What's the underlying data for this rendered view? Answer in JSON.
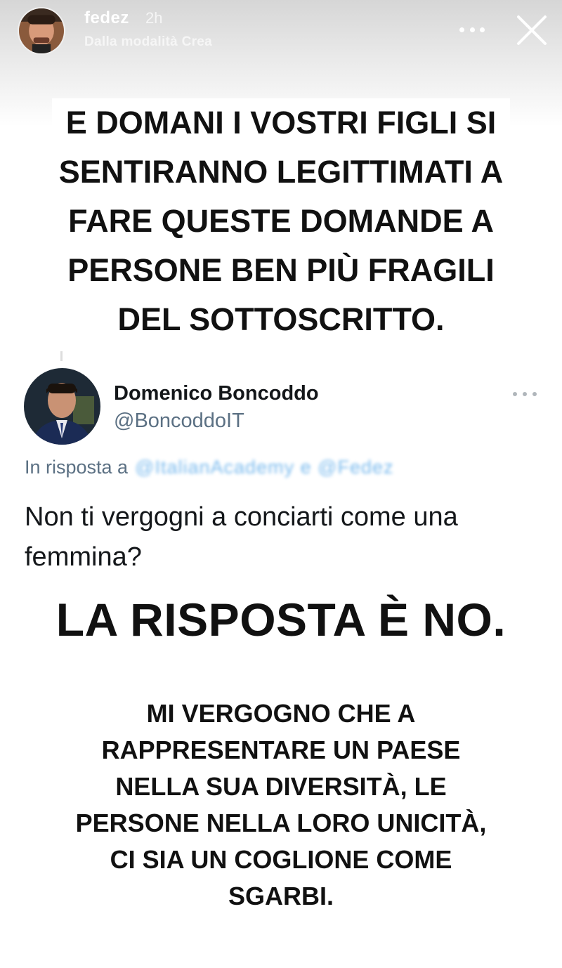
{
  "story": {
    "username": "fedez",
    "time": "2h",
    "subtitle": "Dalla modalità Crea"
  },
  "caption_top": {
    "lines": [
      "E DOMANI I VOSTRI FIGLI SI",
      "SENTIRANNO LEGITTIMATI A",
      "FARE QUESTE DOMANDE A",
      "PERSONE BEN PIÙ FRAGILI",
      "DEL SOTTOSCRITTO."
    ]
  },
  "tweet": {
    "name": "Domenico Boncoddo",
    "handle": "@BoncoddoIT",
    "reply_prefix": "In risposta a",
    "reply_to_blurred": "@ItalianAcademy e @Fedez",
    "text": "Non ti vergogni a conciarti come una femmina?"
  },
  "caption_middle": {
    "text": "LA RISPOSTA È NO."
  },
  "caption_bottom": {
    "lines": [
      "MI VERGOGNO CHE A",
      "RAPPRESENTARE UN PAESE",
      "NELLA SUA DIVERSITÀ, LE",
      "PERSONE NELLA LORO UNICITÀ,",
      "CI SIA UN COGLIONE COME",
      "SGARBI."
    ]
  },
  "icons": {
    "more": "more-horizontal-icon",
    "close": "close-icon",
    "tweet_more": "tweet-more-icon"
  }
}
